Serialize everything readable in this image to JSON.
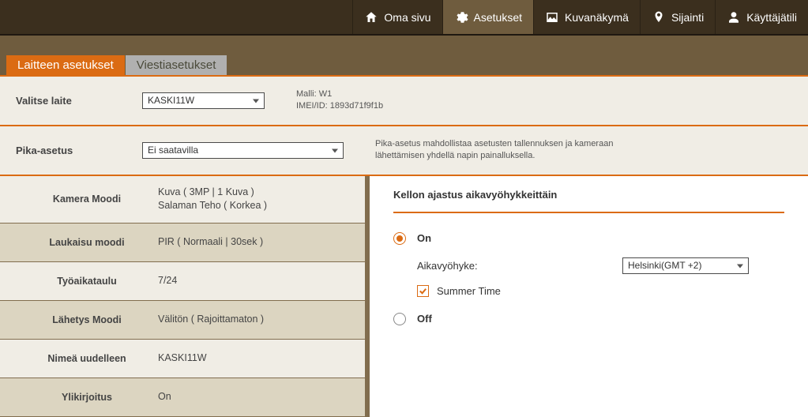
{
  "topnav": {
    "items": [
      {
        "label": "Oma sivu"
      },
      {
        "label": "Asetukset"
      },
      {
        "label": "Kuvanäkymä"
      },
      {
        "label": "Sijainti"
      },
      {
        "label": "Käyttäjätili"
      }
    ]
  },
  "tabs": {
    "device": "Laitteen asetukset",
    "message": "Viestiasetukset"
  },
  "device_select": {
    "label": "Valitse laite",
    "value": "KASKI11W",
    "model_label": "Malli:",
    "model_value": "W1",
    "imei_label": "IMEI/ID:",
    "imei_value": "1893d71f9f1b"
  },
  "quick": {
    "label": "Pika-asetus",
    "value": "Ei saatavilla",
    "help": "Pika-asetus mahdollistaa asetusten tallennuksen ja kameraan lähettämisen yhdellä napin painalluksella."
  },
  "settings_list": [
    {
      "label": "Kamera Moodi",
      "value_line1": "Kuva  (  3MP  |   1 Kuva  )",
      "value_line2": "Salaman Teho  (  Korkea  )"
    },
    {
      "label": "Laukaisu moodi",
      "value_line1": "PIR  (  Normaali  |   30sek  )",
      "value_line2": ""
    },
    {
      "label": "Työaikataulu",
      "value_line1": "7/24",
      "value_line2": ""
    },
    {
      "label": "Lähetys Moodi",
      "value_line1": "Välitön  (  Rajoittamaton  )",
      "value_line2": ""
    },
    {
      "label": "Nimeä uudelleen",
      "value_line1": "KASKI11W",
      "value_line2": ""
    },
    {
      "label": "Ylikirjoitus",
      "value_line1": "On",
      "value_line2": ""
    }
  ],
  "clock_section": {
    "title": "Kellon ajastus aikavyöhykkeittäin",
    "on_label": "On",
    "off_label": "Off",
    "tz_label": "Aikavyöhyke:",
    "tz_value": "Helsinki(GMT +2)",
    "summer_label": "Summer Time"
  }
}
